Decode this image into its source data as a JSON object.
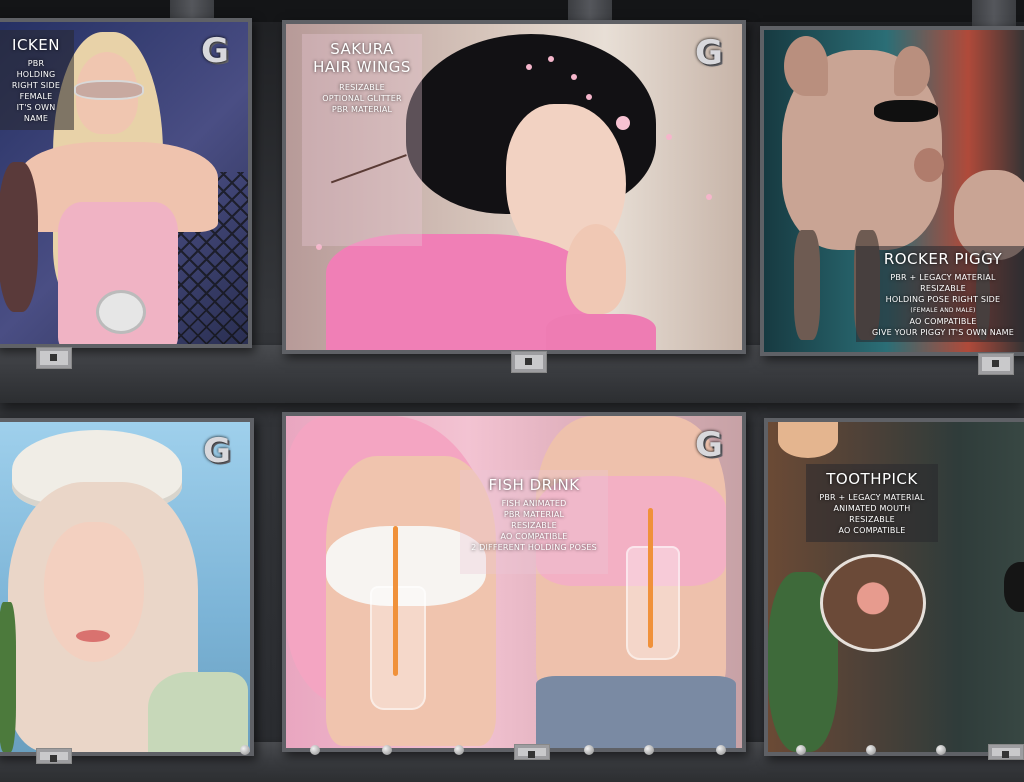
{
  "brand": {
    "logo_letter": "G"
  },
  "vendors": {
    "chicken": {
      "title": "ICKEN",
      "lines": [
        "PBR",
        "HOLDING RIGHT SIDE",
        "FEMALE",
        "IT'S OWN NAME"
      ],
      "colors": {
        "bg": "#2f3a6a",
        "accent": "#e8a9bd"
      }
    },
    "sakura": {
      "title": "SAKURA HAIR WINGS",
      "lines": [
        "RESIZABLE",
        "OPTIONAL GLITTER",
        "PBR MATERIAL"
      ],
      "colors": {
        "bg": "#c9b7b0",
        "accent": "#f2a7c4"
      }
    },
    "piggy": {
      "title": "ROCKER PIGGY",
      "lines": [
        "PBR + LEGACY MATERIAL",
        "RESIZABLE",
        "HOLDING POSE RIGHT SIDE",
        "(FEMALE AND MALE)",
        "AO COMPATIBLE",
        "GIVE YOUR PIGGY IT'S OWN NAME"
      ],
      "colors": {
        "bg": "#1f4d55",
        "accent": "#c9a38f"
      }
    },
    "flower": {
      "colors": {
        "bg": "#8fc3e0",
        "accent": "#eeeae4"
      }
    },
    "fish": {
      "title": "FISH DRINK",
      "lines": [
        "FISH ANIMATED",
        "PBR MATERIAL",
        "RESIZABLE",
        "AO COMPATIBLE",
        "2 DIFFERENT HOLDING POSES"
      ],
      "colors": {
        "bg": "#e2a7bd",
        "accent": "#f0913a"
      }
    },
    "toothpick": {
      "title": "TOOTHPICK",
      "lines": [
        "PBR + LEGACY MATERIAL",
        "ANIMATED MOUTH",
        "RESIZABLE",
        "AO COMPATIBLE"
      ],
      "colors": {
        "bg": "#5c4a3a",
        "accent": "#e4b58f"
      }
    }
  }
}
